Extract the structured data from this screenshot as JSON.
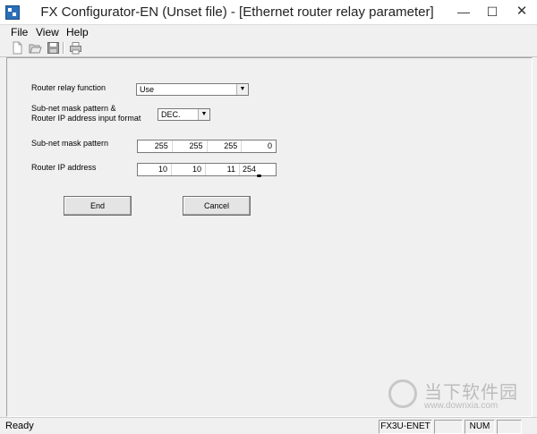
{
  "window": {
    "title": "FX Configurator-EN (Unset file) - [Ethernet router relay parameter]"
  },
  "menu": {
    "items": [
      "File",
      "View",
      "Help"
    ]
  },
  "toolbar": {
    "icons": [
      "new-file-icon",
      "open-folder-icon",
      "save-icon",
      "print-icon"
    ]
  },
  "form": {
    "router_relay_function": {
      "label": "Router relay function",
      "value": "Use"
    },
    "format": {
      "label_line1": "Sub-net mask pattern &",
      "label_line2": "Router IP address input format",
      "value": "DEC."
    },
    "subnet_mask": {
      "label": "Sub-net mask pattern",
      "octets": [
        "255",
        "255",
        "255",
        "0"
      ]
    },
    "router_ip": {
      "label": "Router IP address",
      "octets": [
        "10",
        "10",
        "11",
        "254"
      ]
    },
    "end_label": "End",
    "cancel_label": "Cancel"
  },
  "statusbar": {
    "text": "Ready",
    "model": "FX3U-ENET",
    "num": "NUM"
  },
  "watermark": {
    "text": "当下软件园",
    "url": "www.downxia.com"
  }
}
